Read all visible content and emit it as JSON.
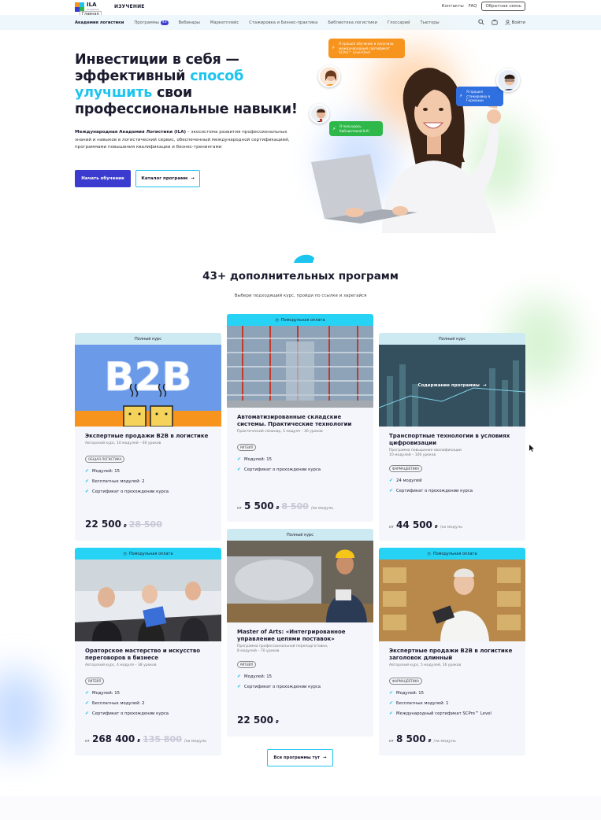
{
  "header": {
    "brand": "ILA",
    "brand_sub": "Академия логистики",
    "home_tooltip": "Главная",
    "section": "ИЗУЧЕНИЕ",
    "contacts": "Контакты",
    "faq": "FAQ",
    "feedback": "Обратная связь"
  },
  "nav": {
    "items": [
      {
        "label": "Академия логистики",
        "active": true
      },
      {
        "label": "Программы",
        "badge": "43"
      },
      {
        "label": "Вебинары"
      },
      {
        "label": "Маркетплейс"
      },
      {
        "label": "Стажировка и Бизнес-практика"
      },
      {
        "label": "Библиотека логистики"
      },
      {
        "label": "Глоссарий"
      },
      {
        "label": "Тьюторы"
      }
    ],
    "login": "Войти",
    "icons": [
      "search-icon",
      "briefcase-icon",
      "user-icon"
    ]
  },
  "hero": {
    "title_1": "Инвестиции в себя —",
    "title_2a": "эффективный ",
    "title_2b": "способ",
    "title_3a": "улучшить",
    "title_3b": " свои",
    "title_4": "профессиональные навыки!",
    "desc_bold": "Международная Академия Логистики (ILA)",
    "desc_rest": " – экосистема развития профессиональных знаний и навыков в логистический сервис, обеспеченный международной сертификацией, программами повышения квалификации и бизнес-тренингами",
    "btn_start": "Начать обучение",
    "btn_catalog": "Каталог программ",
    "bubbles": {
      "orange": "Я прошел обучение и получила международный сертификат SCPro™ Level One!",
      "blue": "Я прошел стажировку в Германии",
      "green": "Я пользуюсь библиотекой ILA!"
    }
  },
  "programs": {
    "title": "43+ дополнительных программ",
    "subtitle": "Выбери подходящий курс, пройди по ссылке и зарегайся",
    "all_button": "Все программы тут",
    "overlay_link": "Содержание программы",
    "cards": [
      {
        "tag": "Полный курс",
        "title": "Экспертные продажи B2B в логистике",
        "meta": "Авторский курс, 10 модулей – 60 уроков",
        "chip": "ОБЩАЯ ЛОГИСТИКА",
        "features": [
          "Модулей: 15",
          "Бесплатных модулей: 2",
          "Сертификат о прохождении курса"
        ],
        "from": "",
        "price": "22 500",
        "currency": "₽",
        "old": "28 500",
        "per": ""
      },
      {
        "tag": "Помодульная оплата",
        "title": "Автоматизированные складские системы. Практические технологии",
        "meta": "Практический семинар, 5 модуля – 30 уроков",
        "chip": "РИТЕЙЛ",
        "features": [
          "Модулей: 15",
          "Сертификат о прохождении курса"
        ],
        "from": "от",
        "price": "5 500",
        "currency": "₽",
        "old": "8 500",
        "per": "/за модуль"
      },
      {
        "tag": "Полный курс",
        "title": "Транспортные технологии в условиях цифровизации",
        "meta": "Программа повышения квалификации\n10 модулей – 100 уроков",
        "chip": "ФАРМАЦЕВТИКА",
        "features": [
          "24 модулей",
          "Сертификат о прохождении курса"
        ],
        "from": "от",
        "price": "44 500",
        "currency": "₽",
        "old": "",
        "per": "/за модуль"
      },
      {
        "tag": "Помодульная оплата",
        "title": "Ораторское мастерство и искусство переговоров в бизнесе",
        "meta": "Авторский курс, 4 модуля – 38 уроков",
        "chip": "РИТЕЙЛ",
        "features": [
          "Модулей: 15",
          "Бесплатных модулей: 2",
          "Сертификат о прохождении курса"
        ],
        "from": "от",
        "price": "268 400",
        "currency": "₽",
        "old": "135 800",
        "per": "/за модуль"
      },
      {
        "tag": "Полный курс",
        "title": "Master of Arts: «Интегрированное управление цепями поставок»",
        "meta": "Программа профессиональной переподготовки,\n8 модулей – 70 уроков",
        "chip": "РИТЕЙЛ",
        "features": [
          "Модулей: 15",
          "Сертификат о прохождении курса"
        ],
        "from": "",
        "price": "22 500",
        "currency": "₽",
        "old": "",
        "per": ""
      },
      {
        "tag": "Помодульная оплата",
        "title": "Экспертные продажи B2B в логистике заголовок длинный",
        "meta": "Авторский курс, 5 модулей, 16 уроков",
        "chip": "ФАРМАЦЕВТИКА",
        "features": [
          "Модулей: 15",
          "Бесплатных модулей: 1",
          "Международный сертификат SCPro™ Level"
        ],
        "from": "от",
        "price": "8 500",
        "currency": "₽",
        "old": "",
        "per": "/за модуль"
      }
    ]
  },
  "colors": {
    "accent": "#1ec4f0",
    "primary": "#3b3ccf",
    "dark": "#1a1a2e"
  }
}
